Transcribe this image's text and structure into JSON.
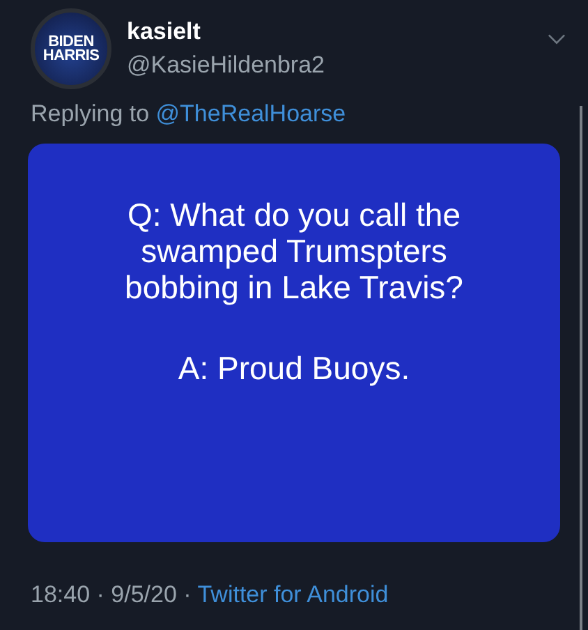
{
  "author": {
    "avatar_lines": [
      "BIDEN",
      "HARRIS"
    ],
    "name": "kasielt",
    "handle": "@KasieHildenbra2"
  },
  "reply_to": {
    "label": "Replying to",
    "handle": "@TheRealHoarse"
  },
  "image_card": {
    "paragraphs": [
      [
        "Q: What do you call the",
        "swamped Trumspters",
        "bobbing in Lake Travis?"
      ],
      [
        "A: Proud Buoys."
      ]
    ]
  },
  "footer": {
    "timestamp": "18:40 · 9/5/20 ·",
    "source": "Twitter for Android"
  }
}
